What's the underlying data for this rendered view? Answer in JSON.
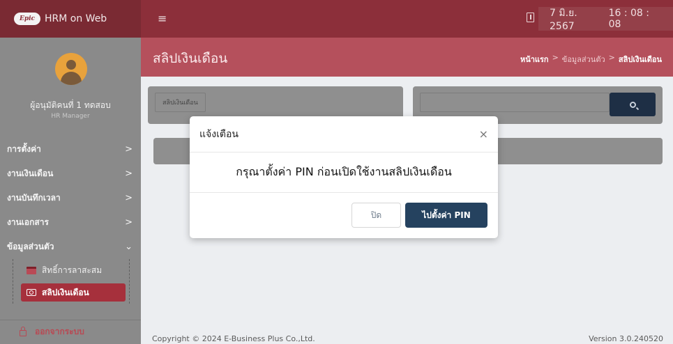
{
  "topbar": {
    "brand_logo": "Epic",
    "brand_title": "HRM on Web",
    "date": "7 มิ.ย. 2567",
    "time": "16 : 08 : 08"
  },
  "page": {
    "title": "สลิปเงินเดือน",
    "breadcrumb": {
      "home": "หน้าแรก",
      "sep1": ">",
      "parent": "ข้อมูลส่วนตัว",
      "sep2": ">",
      "current": "สลิปเงินเดือน"
    }
  },
  "sidebar": {
    "user_name": "ผู้อนุมัติคนที่ 1 ทดสอบ",
    "user_role": "HR Manager",
    "menu": [
      {
        "label": "การตั้งค่า",
        "arrow": ">"
      },
      {
        "label": "งานเงินเดือน",
        "arrow": ">"
      },
      {
        "label": "งานบันทึกเวลา",
        "arrow": ">"
      },
      {
        "label": "งานเอกสาร",
        "arrow": ">"
      },
      {
        "label": "ข้อมูลส่วนตัว",
        "arrow": "⌄"
      }
    ],
    "submenu": [
      {
        "label": "สิทธิ์การลาสะสม"
      },
      {
        "label": "สลิปเงินเดือน"
      }
    ],
    "logout": "ออกจากระบบ"
  },
  "content": {
    "filter_label": "สลิปเงินเดือน"
  },
  "footer": {
    "copyright": "Copyright © 2024 E-Business Plus Co.,Ltd.",
    "version": "Version 3.0.240520"
  },
  "modal": {
    "title": "แจ้งเตือน",
    "close_icon": "×",
    "message": "กรุณาตั้งค่า PIN ก่อนเปิดใช้งานสลิปเงินเดือน",
    "close_label": "ปิด",
    "confirm_label": "ไปตั้งค่า PIN"
  }
}
